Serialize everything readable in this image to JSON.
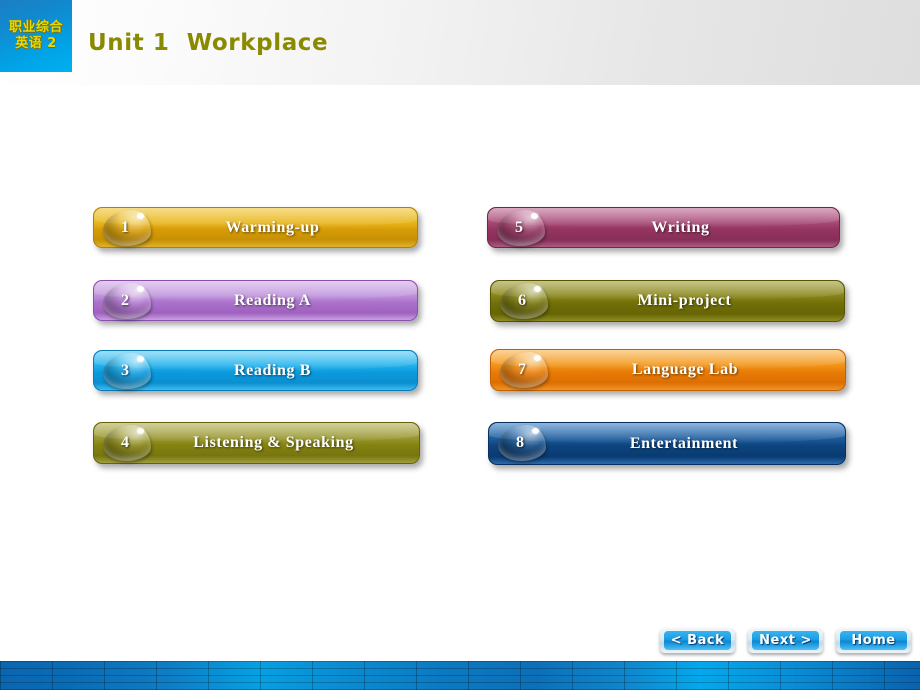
{
  "header": {
    "logo_line1": "职业综合",
    "logo_line2": "英语 2",
    "title": "Unit 1  Workplace",
    "title_color": "#8a8a00",
    "logo_bg_color": "#00a3e6"
  },
  "menu": {
    "items": [
      {
        "number": "1",
        "label": "Warming-up",
        "color_top": "#f0c432",
        "color_mid": "#e2a90b",
        "color_bottom": "#c79104",
        "border": "#b07f04"
      },
      {
        "number": "2",
        "label": "Reading A",
        "color_top": "#c79fe0",
        "color_mid": "#b87ed2",
        "color_bottom": "#a061bf",
        "border": "#8b4fae"
      },
      {
        "number": "3",
        "label": "Reading B",
        "color_top": "#4fc4f0",
        "color_mid": "#13a9e8",
        "color_bottom": "#0b8fd0",
        "border": "#0a7ab4"
      },
      {
        "number": "4",
        "label": "Listening  & Speaking",
        "color_top": "#a5a34a",
        "color_mid": "#8e8c22",
        "color_bottom": "#77750f",
        "border": "#656309"
      },
      {
        "number": "5",
        "label": "Writing",
        "color_top": "#b25a84",
        "color_mid": "#9e3f6d",
        "color_bottom": "#872f59",
        "border": "#73244a"
      },
      {
        "number": "6",
        "label": "Mini-project",
        "color_top": "#93912c",
        "color_mid": "#7c7a0c",
        "color_bottom": "#676505",
        "border": "#565403"
      },
      {
        "number": "7",
        "label": "Language  Lab",
        "color_top": "#f5a623",
        "color_mid": "#ef8a09",
        "color_bottom": "#dd6f02",
        "border": "#c26002"
      },
      {
        "number": "8",
        "label": "Entertainment",
        "color_top": "#2f6fb5",
        "color_mid": "#14508f",
        "color_bottom": "#0a3a71",
        "border": "#07305f"
      }
    ]
  },
  "nav": {
    "back_label": "< Back",
    "next_label": "Next >",
    "home_label": "Home"
  },
  "footer": {
    "accent_color": "#0b7ac2"
  }
}
